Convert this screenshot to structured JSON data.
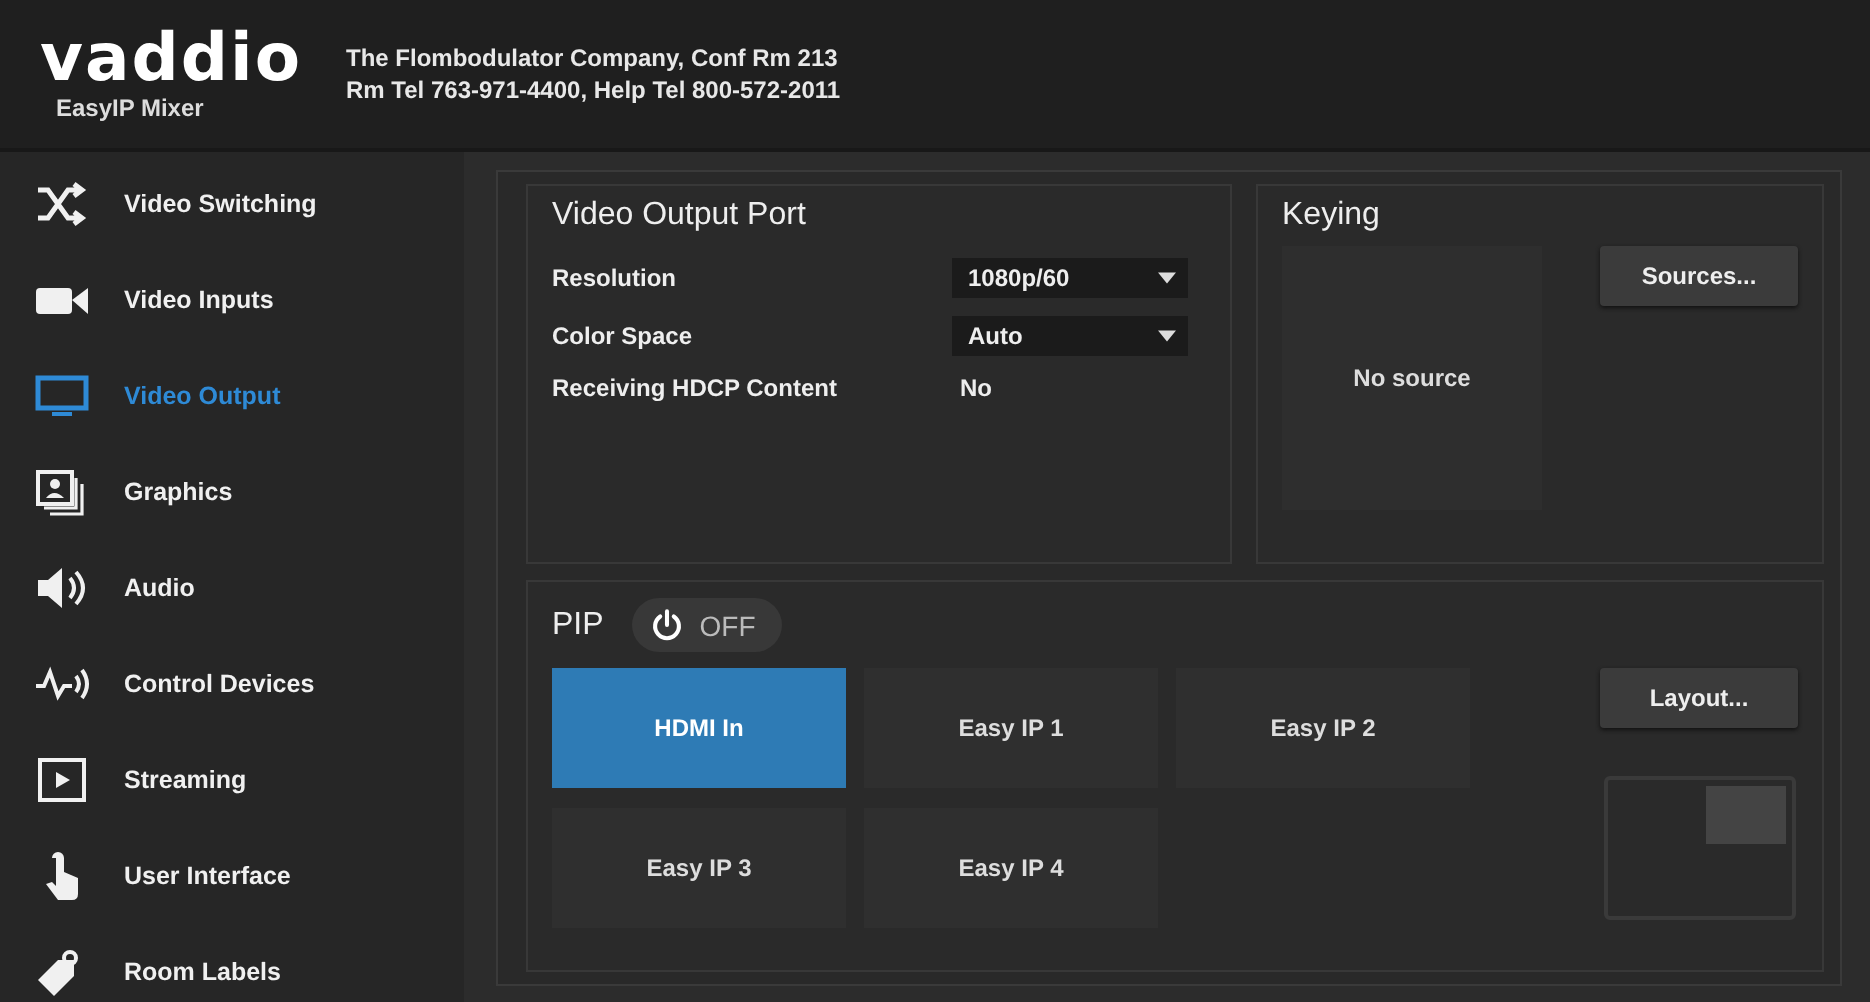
{
  "header": {
    "logo": "vaddio",
    "product": "EasyIP Mixer",
    "info_line_1": "The Flombodulator Company, Conf Rm 213",
    "info_line_2": "Rm Tel 763-971-4400, Help Tel 800-572-2011"
  },
  "sidebar": {
    "items": [
      {
        "label": "Video Switching",
        "selected": false
      },
      {
        "label": "Video Inputs",
        "selected": false
      },
      {
        "label": "Video Output",
        "selected": true
      },
      {
        "label": "Graphics",
        "selected": false
      },
      {
        "label": "Audio",
        "selected": false
      },
      {
        "label": "Control Devices",
        "selected": false
      },
      {
        "label": "Streaming",
        "selected": false
      },
      {
        "label": "User Interface",
        "selected": false
      },
      {
        "label": "Room Labels",
        "selected": false
      }
    ]
  },
  "video_output_port": {
    "title": "Video Output Port",
    "fields": [
      {
        "kind": "select",
        "label": "Resolution",
        "value": "1080p/60"
      },
      {
        "kind": "select",
        "label": "Color Space",
        "value": "Auto"
      },
      {
        "kind": "text",
        "label": "Receiving HDCP Content",
        "value": "No"
      }
    ]
  },
  "keying": {
    "title": "Keying",
    "preview": "No source",
    "button": "Sources..."
  },
  "pip": {
    "title": "PIP",
    "toggle": {
      "on": false,
      "label": "OFF"
    },
    "sources": [
      {
        "label": "HDMI In",
        "selected": true
      },
      {
        "label": "Easy IP 1",
        "selected": false
      },
      {
        "label": "Easy IP 2",
        "selected": false
      },
      {
        "label": "Easy IP 3",
        "selected": false
      },
      {
        "label": "Easy IP 4",
        "selected": false
      }
    ],
    "button": "Layout..."
  }
}
